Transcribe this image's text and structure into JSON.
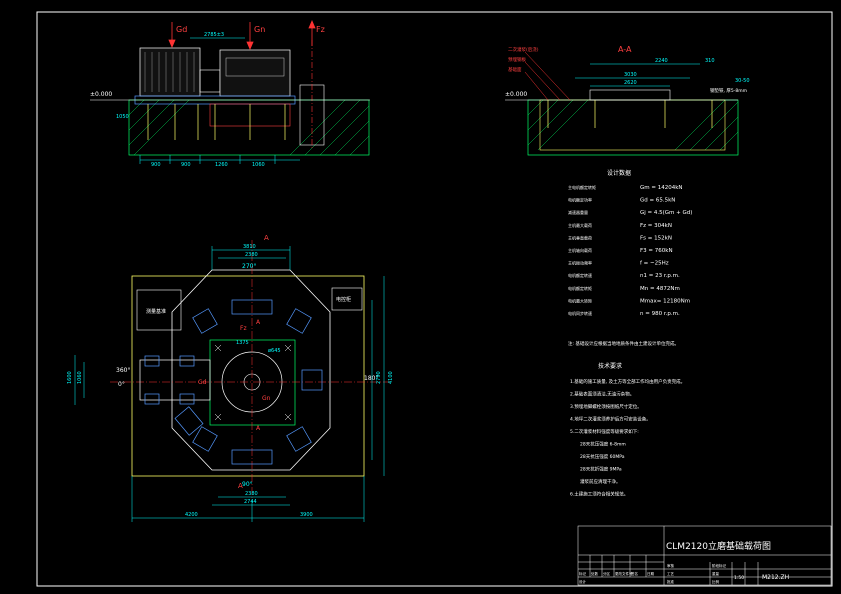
{
  "colors": {
    "background": "#000000",
    "frame": "#ffffff",
    "outline": "#ffffff",
    "dimension": "#00ffff",
    "centerline": "#ff3333",
    "detail": "#00ff66",
    "foundation": "#ffff66",
    "hatch": "#00ff66",
    "part": "#5599ff",
    "text": "#ffffff",
    "label_red": "#ff4040"
  },
  "elevation": {
    "ground_level": "±0.000",
    "forces": [
      "Gd",
      "Gn",
      "Fz"
    ],
    "dim_top": "2785±3",
    "dims_bottom": [
      "900",
      "900",
      "1260",
      "1060"
    ],
    "dim_left": "1050"
  },
  "section": {
    "title": "A-A",
    "ground_level": "±0.000",
    "dim_top": "2240",
    "dim_top_right": "310",
    "dim_mid": "3030",
    "dim_inner": "2620",
    "dim_right": "30-50",
    "callouts": [
      "二次灌浆(后浇)",
      "预埋钢板",
      "基础面"
    ],
    "right_note": "钢垫铁, 厚5-8mm"
  },
  "plan": {
    "section_mark": "A",
    "dims_top": [
      "3810",
      "2380",
      "270°"
    ],
    "dims_bottom": [
      "90°",
      "2380",
      "2744"
    ],
    "dims_base": [
      "4200",
      "3900"
    ],
    "dim_left_a": "1600",
    "dim_left_b": "1060",
    "dim_right_a": "2790",
    "dim_right_b": "4100",
    "angle_left_top": "360°",
    "angle_left": "0°",
    "angle_right": "180°",
    "center_dims": [
      "ø645",
      "1375"
    ],
    "left_box_label": "测量基准",
    "right_box_label": "电控柜",
    "marks": [
      "Fz",
      "Gd",
      "Gn",
      "A",
      "A"
    ]
  },
  "specs": {
    "title": "设计数据",
    "rows": [
      {
        "label": "主电机额定转矩",
        "value": "Gm = 14204kN"
      },
      {
        "label": "电机额定功率",
        "value": "Gd = 65.5kN"
      },
      {
        "label": "减速器重量",
        "value": "Gj = 4.5(Gm + Gd)"
      },
      {
        "label": "主机最大载荷",
        "value": "Fz = 304kN"
      },
      {
        "label": "主机垂直载荷",
        "value": "Fs = 152kN"
      },
      {
        "label": "主机轴向载荷",
        "value": "F3 = 760kN"
      },
      {
        "label": "主机振动频率",
        "value": "f = ~25Hz"
      },
      {
        "label": "电机额定转速",
        "value": "n1 = 23 r.p.m."
      },
      {
        "label": "电机额定转矩",
        "value": "Mn = 4872Nm"
      },
      {
        "label": "电机最大转矩",
        "value": "Mmax= 12180Nm"
      },
      {
        "label": "电机同步转速",
        "value": "n = 980 r.p.m."
      }
    ],
    "note": "注: 基础设计应根据当地地质条件由土建设计单位完成。"
  },
  "requirements": {
    "title": "技术要求",
    "items": [
      "1.基础的施工质量, 及土方等全部工作均由用户负责完成。",
      "2.基础表面须清洁,无油污杂物。",
      "3.预埋地脚螺栓须按图纸尺寸定位。",
      "4.地坪二次灌浆须养护后方可安装设备。",
      "5.二次灌浆材料强度等级要求如下:",
      "28天抗压强度  6-8mm",
      "28天抗压强度  60MPa",
      "28天抗折强度  9MPa",
      "灌浆前应清理干净。",
      "6.土建施工须符合相关规范。"
    ]
  },
  "title_block": {
    "title": "CLM2120立磨基础载荷图",
    "drawing_no": "M212.ZH",
    "scale": "1:50",
    "row_labels": [
      "标记",
      "处数",
      "分区",
      "更改文件号",
      "签名",
      "日期"
    ],
    "design": "设计",
    "check": "审核",
    "process": "工艺",
    "approve": "批准",
    "stage": "阶段标记",
    "weight": "重量",
    "ratio": "比例"
  }
}
